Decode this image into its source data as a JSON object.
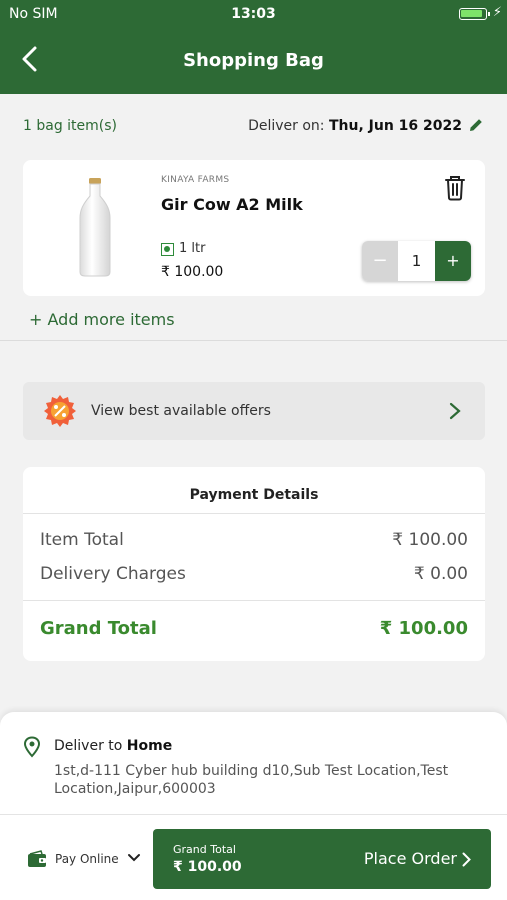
{
  "status_bar": {
    "carrier": "No SIM",
    "time": "13:03"
  },
  "header": {
    "title": "Shopping Bag",
    "back_icon": "chevron-left-icon"
  },
  "summary": {
    "bag_count": "1 bag item(s)",
    "deliver_on_label": "Deliver on:",
    "deliver_date": "Thu, Jun 16 2022"
  },
  "item": {
    "brand": "KINAYA FARMS",
    "name": "Gir Cow A2 Milk",
    "quantity_unit": "1 ltr",
    "price": "₹  100.00",
    "stepper": {
      "minus": "−",
      "value": "1",
      "plus": "+"
    }
  },
  "add_more": "+ Add more items",
  "offers": {
    "label": "View best available offers",
    "icon": "discount-badge-icon"
  },
  "payment": {
    "title": "Payment Details",
    "rows": [
      {
        "label": "Item Total",
        "value": "₹ 100.00"
      },
      {
        "label": "Delivery Charges",
        "value": "₹ 0.00"
      }
    ],
    "grand_total": {
      "label": "Grand Total",
      "value": "₹ 100.00"
    }
  },
  "delivery": {
    "prefix": "Deliver to ",
    "place": "Home",
    "address": "1st,d-111 Cyber hub building d10,Sub Test Location,Test Location,Jaipur,600003"
  },
  "footer": {
    "pay_method": "Pay Online",
    "order_label": "Grand Total",
    "order_amount": "₹ 100.00",
    "place_order": "Place Order"
  },
  "colors": {
    "brand_green": "#2d6a35",
    "total_green": "#3a8a2e"
  }
}
